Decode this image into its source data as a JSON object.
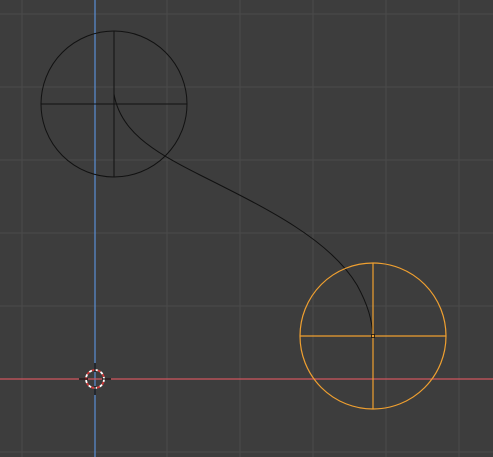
{
  "viewport": {
    "background": "#3d3d3d",
    "grid_color": "#4a4a4a",
    "x_axis_color": "#d0565e",
    "y_axis_color": "#5a8fd6",
    "selected_color": "#f0a030",
    "unselected_color": "#111111"
  },
  "objects": [
    {
      "name": "circle-empty-unselected",
      "selected": false
    },
    {
      "name": "circle-empty-selected",
      "selected": true
    }
  ],
  "icons": {
    "cursor": "3d-cursor-icon",
    "origin": "object-origin-dot"
  }
}
